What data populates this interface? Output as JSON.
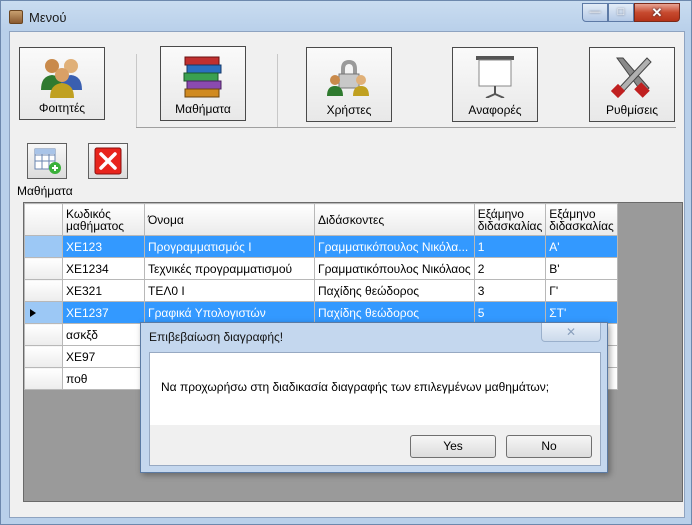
{
  "window": {
    "title": "Μενού",
    "controls": {
      "minimize": "—",
      "maximize": "□",
      "close": "✕"
    }
  },
  "toolbar": {
    "buttons": [
      {
        "label": "Φοιτητές",
        "icon": "students-icon"
      },
      {
        "label": "Μαθήματα",
        "icon": "books-icon"
      },
      {
        "label": "Χρήστες",
        "icon": "users-lock-icon"
      },
      {
        "label": "Αναφορές",
        "icon": "projector-screen-icon"
      },
      {
        "label": "Ρυθμίσεις",
        "icon": "tools-icon"
      }
    ]
  },
  "actions": {
    "add_icon": "add-table-icon",
    "delete_icon": "delete-x-icon"
  },
  "section_label": "Μαθήματα",
  "grid": {
    "columns": [
      "Κωδικός μαθήματος",
      "Όνομα",
      "Διδάσκοντες",
      "Εξάμηνο διδασκαλίας",
      "Εξάμηνο διδασκαλίας"
    ],
    "rows": [
      {
        "selected": true,
        "current": false,
        "cells": [
          "ΧΕ123",
          "Προγραμματισμός Ι",
          "Γραμματικόπουλος Νικόλα...",
          "1",
          "Α'"
        ]
      },
      {
        "selected": false,
        "current": false,
        "cells": [
          "ΧΕ1234",
          "Τεχνικές προγραμματισμού",
          "Γραμματικόπουλος Νικόλαος",
          "2",
          "Β'"
        ]
      },
      {
        "selected": false,
        "current": false,
        "cells": [
          "ΧΕ321",
          "ΤΕΛ0 Ι",
          "Παχίδης θεώδορος",
          "3",
          "Γ'"
        ]
      },
      {
        "selected": true,
        "current": true,
        "cells": [
          "ΧΕ1237",
          "Γραφικά Υπολογιστών",
          "Παχίδης θεώδορος",
          "5",
          "ΣΤ'"
        ]
      },
      {
        "selected": false,
        "current": false,
        "cells": [
          "ασκξδ",
          "",
          "",
          "",
          ""
        ]
      },
      {
        "selected": false,
        "current": false,
        "cells": [
          "ΧΕ97",
          "",
          "",
          "",
          ""
        ]
      },
      {
        "selected": false,
        "current": false,
        "cells": [
          "ποθ",
          "",
          "",
          "",
          ""
        ]
      }
    ]
  },
  "dialog": {
    "title": "Επιβεβαίωση διαγραφής!",
    "close": "✕",
    "message": "Να προχωρήσω στη διαδικασία διαγραφής των επιλεγμένων μαθημάτων;",
    "yes": "Yes",
    "no": "No"
  },
  "colors": {
    "selection": "#3399ff",
    "delete_button": "#e8241c"
  }
}
